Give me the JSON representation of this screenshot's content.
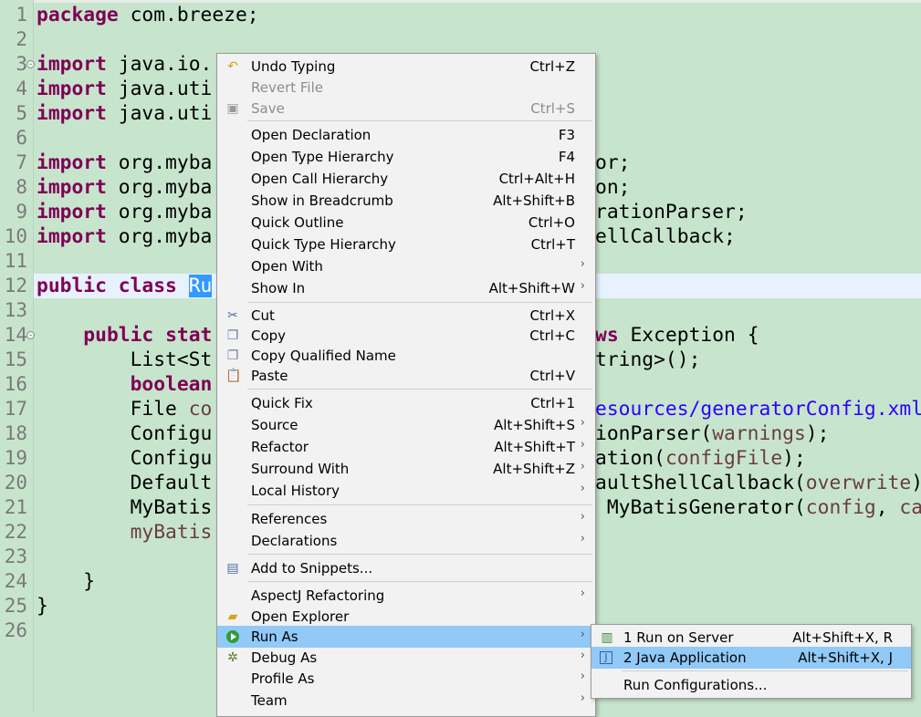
{
  "editor": {
    "line_numbers": [
      "1",
      "2",
      "3",
      "4",
      "5",
      "6",
      "7",
      "8",
      "9",
      "10",
      "11",
      "12",
      "13",
      "14",
      "15",
      "16",
      "17",
      "18",
      "19",
      "20",
      "21",
      "22",
      "23",
      "24",
      "25",
      "26"
    ],
    "line1": {
      "kw": "package",
      "rest": " com.breeze;"
    },
    "line3": {
      "kw": "import",
      "rest": " java.io."
    },
    "line4": {
      "kw": "import",
      "rest": " java.uti"
    },
    "line5": {
      "kw": "import",
      "rest": " java.uti"
    },
    "line7": {
      "kw": "import",
      "rest": " org.myba",
      "tail": "or;"
    },
    "line8": {
      "kw": "import",
      "rest": " org.myba",
      "tail": "on;"
    },
    "line9": {
      "kw": "import",
      "rest": " org.myba",
      "tail": "rationParser;"
    },
    "line10": {
      "kw": "import",
      "rest": " org.myba",
      "tail": "ellCallback;"
    },
    "line12": {
      "kw1": "public",
      "kw2": "class",
      "sel": "Ru"
    },
    "line14": {
      "kw1": "public",
      "kw2": "stat",
      "tail_kw": "ws",
      "tail": " Exception {"
    },
    "line15": {
      "head": "List<St",
      "tail": "tring>();"
    },
    "line16": {
      "kw": "boolean"
    },
    "line17": {
      "head": "File ",
      "var": "co",
      "str": "esources/generatorConfig.xml"
    },
    "line18": {
      "head": "Configu",
      "tail1": "ionParser(",
      "var": "warnings",
      "tail2": ");"
    },
    "line19": {
      "head": "Configu",
      "tail1": "ation(",
      "var": "configFile",
      "tail2": ");"
    },
    "line20": {
      "head": "Default",
      "tail1": "aultShellCallback(",
      "var": "overwrite",
      "tail2": ")"
    },
    "line21": {
      "head": "MyBatis",
      "tail1": " MyBatisGenerator(",
      "var1": "config",
      "tail2": ", ",
      "var2": "ca"
    },
    "line22": {
      "var": "myBatis"
    },
    "line24": {
      "text": "}"
    },
    "line25": {
      "text": "}"
    }
  },
  "context_menu": {
    "items": [
      {
        "label": "Undo Typing",
        "shortcut": "Ctrl+Z",
        "icon": "undo-icon"
      },
      {
        "label": "Revert File",
        "shortcut": "",
        "disabled": true
      },
      {
        "label": "Save",
        "shortcut": "Ctrl+S",
        "disabled": true,
        "icon": "save-icon"
      },
      {
        "label": "Open Declaration",
        "shortcut": "F3"
      },
      {
        "label": "Open Type Hierarchy",
        "shortcut": "F4"
      },
      {
        "label": "Open Call Hierarchy",
        "shortcut": "Ctrl+Alt+H"
      },
      {
        "label": "Show in Breadcrumb",
        "shortcut": "Alt+Shift+B"
      },
      {
        "label": "Quick Outline",
        "shortcut": "Ctrl+O"
      },
      {
        "label": "Quick Type Hierarchy",
        "shortcut": "Ctrl+T"
      },
      {
        "label": "Open With",
        "submenu": true
      },
      {
        "label": "Show In",
        "shortcut": "Alt+Shift+W",
        "submenu": true
      },
      {
        "label": "Cut",
        "shortcut": "Ctrl+X",
        "icon": "scissors-icon"
      },
      {
        "label": "Copy",
        "shortcut": "Ctrl+C",
        "icon": "copy-icon"
      },
      {
        "label": "Copy Qualified Name",
        "icon": "copy-qualified-icon"
      },
      {
        "label": "Paste",
        "shortcut": "Ctrl+V",
        "icon": "paste-icon"
      },
      {
        "label": "Quick Fix",
        "shortcut": "Ctrl+1"
      },
      {
        "label": "Source",
        "shortcut": "Alt+Shift+S",
        "submenu": true
      },
      {
        "label": "Refactor",
        "shortcut": "Alt+Shift+T",
        "submenu": true
      },
      {
        "label": "Surround With",
        "shortcut": "Alt+Shift+Z",
        "submenu": true
      },
      {
        "label": "Local History",
        "submenu": true
      },
      {
        "label": "References",
        "submenu": true
      },
      {
        "label": "Declarations",
        "submenu": true
      },
      {
        "label": "Add to Snippets...",
        "icon": "snippet-icon"
      },
      {
        "label": "AspectJ Refactoring",
        "submenu": true
      },
      {
        "label": "Open Explorer",
        "icon": "folder-icon"
      },
      {
        "label": "Run As",
        "submenu": true,
        "highlighted": true,
        "icon": "run-icon"
      },
      {
        "label": "Debug As",
        "submenu": true,
        "icon": "bug-icon"
      },
      {
        "label": "Profile As",
        "submenu": true
      },
      {
        "label": "Team",
        "submenu": true
      }
    ]
  },
  "run_as_submenu": {
    "items": [
      {
        "label": "1 Run on Server",
        "shortcut": "Alt+Shift+X, R",
        "icon": "server-icon"
      },
      {
        "label": "2 Java Application",
        "shortcut": "Alt+Shift+X, J",
        "icon": "java-app-icon",
        "highlighted": true
      },
      {
        "label": "Run Configurations..."
      }
    ]
  },
  "colors": {
    "editor_bg": "#c7e5cd",
    "keyword": "#7f0055",
    "string": "#2a00ff",
    "highlight": "#91c9f7"
  }
}
